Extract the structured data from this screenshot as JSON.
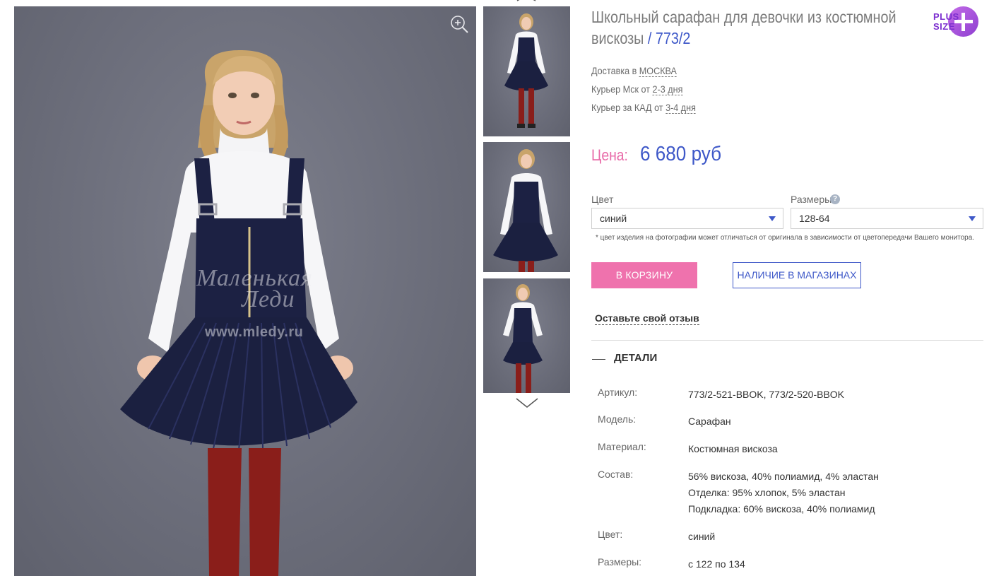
{
  "product": {
    "title": "Школьный сарафан для девочки из костюмной вискозы",
    "article_code": "/ 773/2",
    "plus_size": {
      "line1": "PLUS",
      "line2": "SIZE"
    }
  },
  "delivery": {
    "row1_prefix": "Доставка в",
    "row1_city": "МОСКВА",
    "row2_prefix": "Курьер Мск от",
    "row2_days": "2-3 дня",
    "row3_prefix": "Курьер за КАД от",
    "row3_days": "3-4 дня"
  },
  "price": {
    "label": "Цена:",
    "value": "6 680 руб"
  },
  "options": {
    "color_label": "Цвет",
    "color_value": "синий",
    "size_label": "Размеры",
    "size_value": "128-64",
    "help_glyph": "?",
    "note": "* цвет изделия на фотографии может отличаться от оригинала в зависимости от цветопередачи Вашего монитора."
  },
  "actions": {
    "cart_label": "В КОРЗИНУ",
    "stores_label": "НАЛИЧИЕ В МАГАЗИНАХ",
    "review_label": "Оставьте свой отзыв"
  },
  "details": {
    "header": "ДЕТАЛИ",
    "rows": [
      {
        "key": "Артикул:",
        "value": "773/2-521-BBOK, 773/2-520-BBOK"
      },
      {
        "key": "Модель:",
        "value": "Сарафан"
      },
      {
        "key": "Материал:",
        "value": "Костюмная вискоза"
      },
      {
        "key": "Состав:",
        "value": "56% вискоза, 40% полиамид, 4% эластан",
        "value2": "Отделка: 95% хлопок, 5% эластан",
        "value3": "Подкладка: 60% вискоза, 40% полиамид"
      },
      {
        "key": "Цвет:",
        "value": "синий"
      },
      {
        "key": "Размеры:",
        "value": "с 122 по 134"
      }
    ]
  },
  "gallery": {
    "watermark_line1": "Маленькая",
    "watermark_line2": "Леди",
    "watermark_url": "www.mledy.ru",
    "icons": {
      "zoom": "zoom-in-icon",
      "up": "chevron-up-icon",
      "down": "chevron-down-icon"
    }
  },
  "colors": {
    "accent_blue": "#3e58c8",
    "accent_pink": "#ef72ad",
    "price_label_pink": "#e86aa8",
    "plus_size_purple": "#8e3fd0",
    "photo_bg": "#6c6e7b",
    "dress_navy": "#1c2143"
  }
}
